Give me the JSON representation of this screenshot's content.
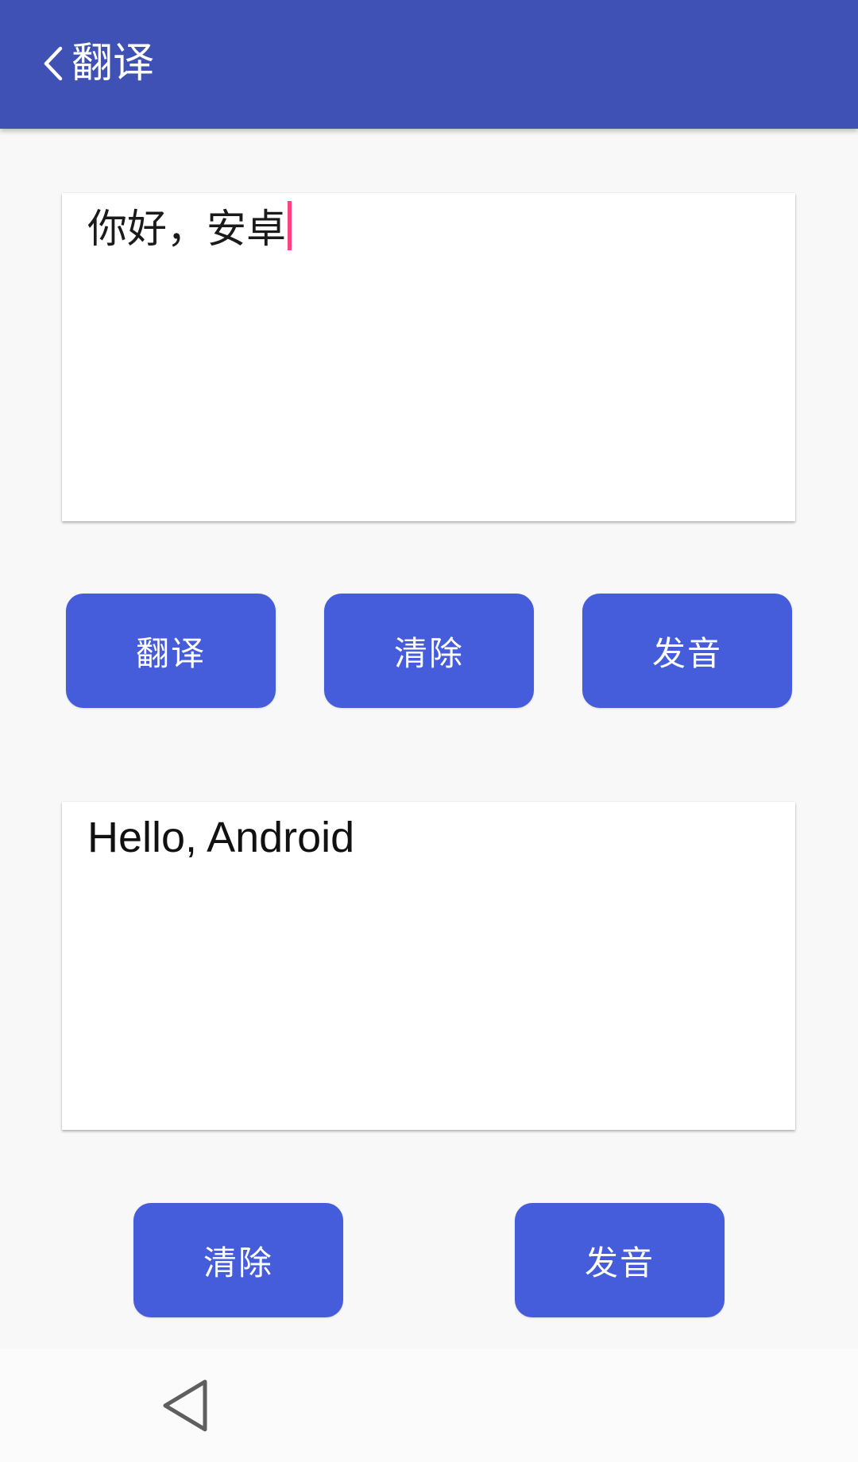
{
  "app_bar": {
    "title": "翻译",
    "back_icon": "chevron-left-icon",
    "background_color": "#3f51b5"
  },
  "source_input": {
    "value": "你好，安卓",
    "caret_color": "#ff4081"
  },
  "top_buttons": {
    "translate_label": "翻译",
    "clear_label": "清除",
    "speak_label": "发音"
  },
  "result_output": {
    "value": "Hello, Android"
  },
  "bottom_buttons": {
    "clear_label": "清除",
    "speak_label": "发音"
  },
  "button_color": "#455cdb",
  "nav_bar": {
    "back_icon": "triangle-back-icon"
  }
}
